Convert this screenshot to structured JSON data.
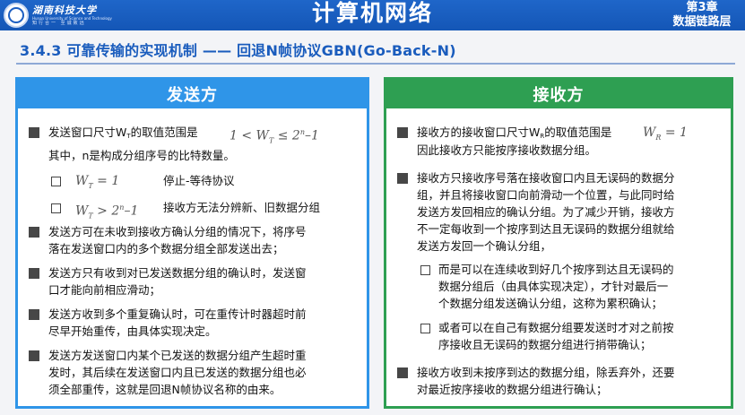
{
  "header": {
    "logo_name": "湖南科技大学",
    "logo_en": "Hunan University of Science and Technology",
    "logo_motto": "知行合一 至诚致远",
    "course_title": "计算机网络",
    "chapter_num": "第3章",
    "chapter_name": "数据链路层",
    "accent_color": "#1d5fc2"
  },
  "section": {
    "title": "3.4.3 可靠传输的实现机制 —— 回退N帧协议GBN(Go-Back-N)"
  },
  "send": {
    "heading": "发送方",
    "color": "#2f95e8",
    "p1": {
      "line1_text": "发送窗口尺寸W",
      "line1_sub": "T",
      "line1_rest": "的取值范围是",
      "math": "1 < W",
      "math_sub": "T",
      "math_rest": " ≤ 2",
      "math_sup": "n",
      "math_end": "–1",
      "line2": "其中，n是构成分组序号的比特数量。"
    },
    "opt1": {
      "math": "W",
      "math_sub": "T",
      "math_rest": " = 1",
      "label": "停止-等待协议"
    },
    "opt2": {
      "math": "W",
      "math_sub": "T",
      "math_rest": " > 2",
      "math_sup": "n",
      "math_end": "–1",
      "label": "接收方无法分辨新、旧数据分组"
    },
    "p2": [
      "发送方可在未收到接收方确认分组的情况下，将序号",
      "落在发送窗口内的多个数据分组全部发送出去；"
    ],
    "p3": [
      "发送方只有收到对已发送数据分组的确认时，发送窗",
      "口才能向前相应滑动；"
    ],
    "p4": [
      "发送方收到多个重复确认时，可在重传计时器超时前",
      "尽早开始重传，由具体实现决定。"
    ],
    "p5": [
      "发送方发送窗口内某个已发送的数据分组产生超时重",
      "发时，其后续在发送窗口内且已发送的数据分组也必",
      "须全部重传，这就是回退N帧协议名称的由来。"
    ]
  },
  "recv": {
    "heading": "接收方",
    "color": "#2e9f52",
    "p1": {
      "line1_text": "接收方的接收窗口尺寸W",
      "line1_sub": "R",
      "line1_rest": "的取值范围是",
      "math": "W",
      "math_sub": "R",
      "math_rest": " = 1",
      "line2": "因此接收方只能按序接收数据分组。"
    },
    "p2": [
      "接收方只接收序号落在接收窗口内且无误码的数据分",
      "组，并且将接收窗口向前滑动一个位置，与此同时给",
      "发送方发回相应的确认分组。为了减少开销，接收方",
      "不一定每收到一个按序到达且无误码的数据分组就给",
      "发送方发回一个确认分组，"
    ],
    "opt1": [
      "而是可以在连续收到好几个按序到达且无误码的",
      "数据分组后（由具体实现决定），才针对最后一",
      "个数据分组发送确认分组，这称为累积确认；"
    ],
    "opt2": [
      "或者可以在自己有数据分组要发送时才对之前按",
      "序接收且无误码的数据分组进行捎带确认；"
    ],
    "p3": [
      "接收方收到未按序到达的数据分组，除丢弃外，还要",
      "对最近按序接收的数据分组进行确认；"
    ]
  }
}
